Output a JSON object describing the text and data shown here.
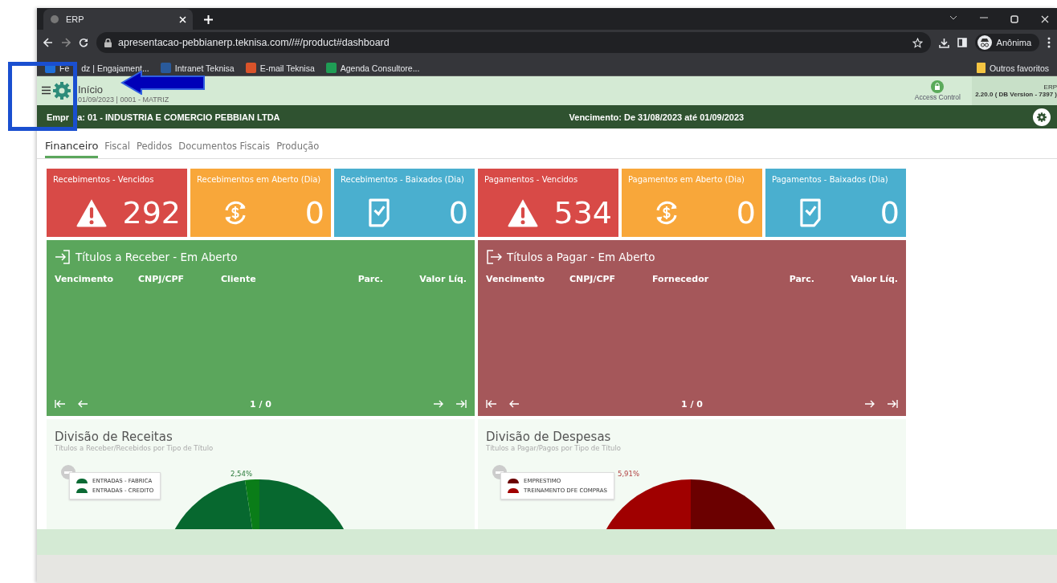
{
  "browser": {
    "tab_title": "ERP",
    "url": "apresentacao-pebbianerp.teknisa.com//#/product#dashboard",
    "profile": "Anônima",
    "bookmarks": [
      {
        "label": [
          "Fe",
          "dz | Engajament..."
        ],
        "color": "#1e6fd9"
      },
      {
        "label": "Intranet Teknisa",
        "color": "#2a5a9a"
      },
      {
        "label": "E-mail Teknisa",
        "color": "#d9532a"
      },
      {
        "label": "Agenda Consultore...",
        "color": "#1f9d55"
      }
    ],
    "other_bookmarks": "Outros favoritos"
  },
  "app_header": {
    "title": "Início",
    "subtitle": "01/09/2023 | 0001 - MATRIZ",
    "access_control": "Access Control",
    "product": "ERP",
    "version": "2.20.0 ( DB Version - 7397 )"
  },
  "company_bar": {
    "company": [
      "Empr",
      "a: 01 - INDUSTRIA E COMERCIO PEBBIAN LTDA"
    ],
    "due": "Vencimento: De 31/08/2023 até 01/09/2023"
  },
  "tabs": [
    {
      "label": "Financeiro",
      "selected": true
    },
    {
      "label": "Fiscal",
      "selected": false
    },
    {
      "label": "Pedidos",
      "selected": false
    },
    {
      "label": "Documentos Fiscais",
      "selected": false
    },
    {
      "label": "Produção",
      "selected": false
    }
  ],
  "cards": [
    {
      "title": "Recebimentos - Vencidos",
      "value": "292",
      "kind": "warning",
      "color": "#d84a47"
    },
    {
      "title": "Recebimentos em Aberto (Dia)",
      "value": "0",
      "kind": "refresh",
      "color": "#f8a73a"
    },
    {
      "title": "Recebimentos - Baixados (Dia)",
      "value": "0",
      "kind": "document",
      "color": "#4aafcf"
    },
    {
      "title": "Pagamentos - Vencidos",
      "value": "534",
      "kind": "warning",
      "color": "#d84a47"
    },
    {
      "title": "Pagamentos em Aberto (Dia)",
      "value": "0",
      "kind": "refresh",
      "color": "#f8a73a"
    },
    {
      "title": "Pagamentos - Baixados (Dia)",
      "value": "0",
      "kind": "document",
      "color": "#4aafcf"
    }
  ],
  "tables": [
    {
      "title": "Títulos a Receber - Em Aberto",
      "kind": "in",
      "color": "#5ba65c",
      "columns": [
        "Vencimento",
        "CNPJ/CPF",
        "Cliente",
        "Parc.",
        "Valor Líq."
      ],
      "pager": "1 / 0"
    },
    {
      "title": "Títulos a Pagar - Em Aberto",
      "kind": "out",
      "color": "#a5575a",
      "columns": [
        "Vencimento",
        "CNPJ/CPF",
        "Fornecedor",
        "Parc.",
        "Valor Líq."
      ],
      "pager": "1 / 0"
    }
  ],
  "charts": [
    {
      "title": "Divisão de Receitas",
      "subtitle": "Títulos a Receber/Recebidos por Tipo de Título",
      "legend": [
        {
          "label": "ENTRADAS - FABRICA",
          "color": "#0b6a34"
        },
        {
          "label": "ENTRADAS - CREDITO",
          "color": "#0b6a34"
        }
      ],
      "percent_label": "2,54%",
      "kind": "green"
    },
    {
      "title": "Divisão de Despesas",
      "subtitle": "Títulos a Pagar/Pagos por Tipo de Título",
      "legend": [
        {
          "label": "EMPRESTIMO",
          "color": "#6b0000"
        },
        {
          "label": "TREINAMENTO DFE COMPRAS",
          "color": "#a00000"
        }
      ],
      "percent_label": "5,91%",
      "kind": "red"
    }
  ]
}
